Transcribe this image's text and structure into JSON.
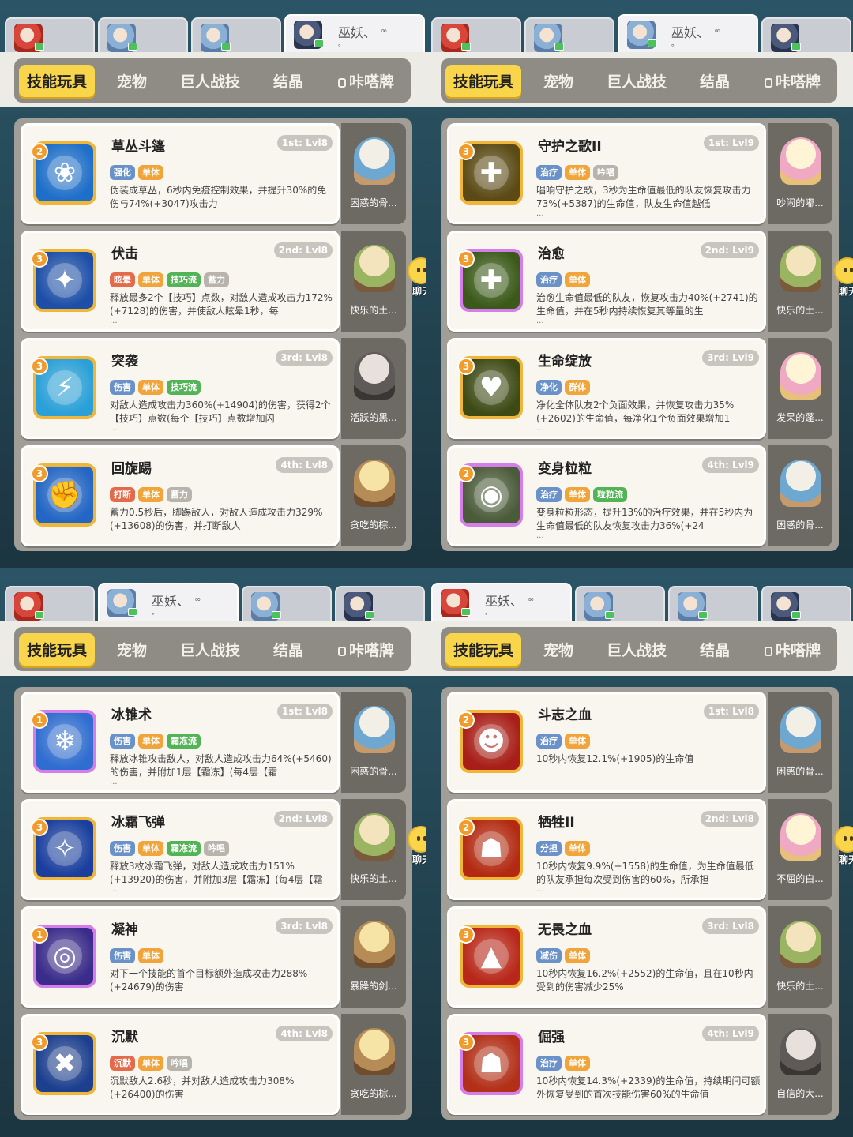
{
  "colors": {
    "tag_blue": "#6a91c8",
    "tag_orange": "#f0a43a",
    "tag_green": "#52b456",
    "tag_gray": "#b8b4ac",
    "tag_red": "#e36a4a",
    "tag_purple": "#a97ad8",
    "highlight_green": "#3b9b3f"
  },
  "panels": [
    {
      "char_tabs": [
        {
          "avatar": "red",
          "name": "",
          "active": false
        },
        {
          "avatar": "blue",
          "name": "",
          "active": false
        },
        {
          "avatar": "blue",
          "name": "",
          "active": false
        },
        {
          "avatar": "dark",
          "name": "巫妖、",
          "dots": "∞",
          "small": "。",
          "active": true
        }
      ],
      "menu": [
        "技能玩具",
        "宠物",
        "巨人战技",
        "结晶",
        "咔嗒牌"
      ],
      "cards": [
        {
          "badge": "2",
          "name": "草丛斗篷",
          "level": "1st: Lvl8",
          "icon": "❀",
          "icon_bg": "#1e6fc9",
          "icon_frame": "gold",
          "tags": [
            {
              "t": "强化",
              "c": "blue"
            },
            {
              "t": "单体",
              "c": "orange"
            }
          ],
          "desc": "伪装成草丛，6秒内免疫控制效果，并提升30%的免伤与74%(+3047)攻击力",
          "more": "",
          "pet": "困惑的骨...",
          "pet_style": "",
          "chat": false
        },
        {
          "badge": "3",
          "name": "伏击",
          "level": "2nd: Lvl8",
          "icon": "✦",
          "icon_bg": "#1d4fa8",
          "icon_frame": "gold",
          "tags": [
            {
              "t": "眩晕",
              "c": "red"
            },
            {
              "t": "单体",
              "c": "orange"
            },
            {
              "t": "技巧流",
              "c": "green"
            },
            {
              "t": "蓄力",
              "c": "gray"
            }
          ],
          "desc": "释放最多2个【技巧】点数，对敌人造成攻击力172%(+7128)的伤害，并使敌人眩晕1秒，每",
          "more": "...",
          "pet": "快乐的土...",
          "pet_style": "green",
          "chat": true
        },
        {
          "badge": "3",
          "name": "突袭",
          "level": "3rd: Lvl8",
          "icon": "⚡",
          "icon_bg": "#2aa0d8",
          "icon_frame": "gold",
          "tags": [
            {
              "t": "伤害",
              "c": "blue"
            },
            {
              "t": "单体",
              "c": "orange"
            },
            {
              "t": "技巧流",
              "c": "green"
            }
          ],
          "desc": "对敌人造成攻击力360%(+14904)的伤害，获得2个【技巧】点数(每个【技巧】点数增加闪",
          "more": "...",
          "pet": "活跃的黑...",
          "pet_style": "dark",
          "chat": false
        },
        {
          "badge": "3",
          "name": "回旋踢",
          "level": "4th: Lvl8",
          "icon": "✊",
          "icon_bg": "#2366c4",
          "icon_frame": "gold",
          "tags": [
            {
              "t": "打断",
              "c": "red"
            },
            {
              "t": "单体",
              "c": "orange"
            },
            {
              "t": "蓄力",
              "c": "gray"
            }
          ],
          "desc": "蓄力0.5秒后，脚踢敌人，对敌人造成攻击力329%(+13608)的伤害，并打断敌人",
          "more": "",
          "pet": "贪吃的棕...",
          "pet_style": "brown",
          "chat": false
        }
      ]
    },
    {
      "char_tabs": [
        {
          "avatar": "red",
          "name": "",
          "active": false
        },
        {
          "avatar": "blue",
          "name": "",
          "active": false
        },
        {
          "avatar": "blue",
          "name": "巫妖、",
          "dots": "∞",
          "small": "。",
          "active": true
        },
        {
          "avatar": "dark",
          "name": "",
          "active": false
        }
      ],
      "menu": [
        "技能玩具",
        "宠物",
        "巨人战技",
        "结晶",
        "咔嗒牌"
      ],
      "cards": [
        {
          "badge": "3",
          "name": "守护之歌II",
          "level": "1st: Lvl9",
          "icon": "✚",
          "icon_bg": "#5b4a16",
          "icon_frame": "gold",
          "tags": [
            {
              "t": "治疗",
              "c": "blue"
            },
            {
              "t": "单体",
              "c": "orange"
            },
            {
              "t": "吟唱",
              "c": "gray"
            }
          ],
          "desc": "唱响守护之歌，3秒为生命值最低的队友恢复攻击力73%(+5387)的生命值，队友生命值越低",
          "more": "...",
          "pet": "吵闹的嘟...",
          "pet_style": "pink",
          "chat": false
        },
        {
          "badge": "3",
          "name": "治愈",
          "level": "2nd: Lvl9",
          "icon": "✚",
          "icon_bg": "#3b5a1a",
          "icon_frame": "purple",
          "tags": [
            {
              "t": "治疗",
              "c": "blue"
            },
            {
              "t": "单体",
              "c": "orange"
            }
          ],
          "desc": "治愈生命值最低的队友，恢复攻击力40%(+2741)的生命值，并在5秒内持续恢复其等量的生",
          "more": "...",
          "pet": "快乐的土...",
          "pet_style": "green",
          "chat": true
        },
        {
          "badge": "3",
          "name": "生命绽放",
          "level": "3rd: Lvl9",
          "icon": "♥",
          "icon_bg": "#3e4a16",
          "icon_frame": "gold",
          "tags": [
            {
              "t": "净化",
              "c": "blue"
            },
            {
              "t": "群体",
              "c": "orange"
            }
          ],
          "desc": "净化全体队友2个负面效果，并恢复攻击力35%(+2602)的生命值，每净化1个负面效果增加1",
          "more": "...",
          "pet": "发呆的蓬...",
          "pet_style": "pink",
          "chat": false
        },
        {
          "badge": "2",
          "name": "变身粒粒",
          "level": "4th: Lvl9",
          "icon": "◉",
          "icon_bg": "#4a5b3a",
          "icon_frame": "purple",
          "tags": [
            {
              "t": "治疗",
              "c": "blue"
            },
            {
              "t": "单体",
              "c": "orange"
            },
            {
              "t": "粒粒流",
              "c": "green"
            }
          ],
          "desc": "变身粒粒形态，提升13%的治疗效果，并在5秒内为生命值最低的队友恢复攻击力36%(+24",
          "more": "...",
          "pet": "困惑的骨...",
          "pet_style": "",
          "chat": false
        }
      ]
    },
    {
      "char_tabs": [
        {
          "avatar": "red",
          "name": "",
          "active": false
        },
        {
          "avatar": "blue",
          "name": "巫妖、",
          "dots": "∞",
          "small": "。",
          "active": true
        },
        {
          "avatar": "blue",
          "name": "",
          "active": false
        },
        {
          "avatar": "dark",
          "name": "",
          "active": false
        }
      ],
      "menu": [
        "技能玩具",
        "宠物",
        "巨人战技",
        "结晶",
        "咔嗒牌"
      ],
      "cards": [
        {
          "badge": "1",
          "name": "冰锥术",
          "level": "1st: Lvl8",
          "icon": "❄",
          "icon_bg": "#2f6dd0",
          "icon_frame": "purple",
          "tags": [
            {
              "t": "伤害",
              "c": "blue"
            },
            {
              "t": "单体",
              "c": "orange"
            },
            {
              "t": "霜冻流",
              "c": "green"
            }
          ],
          "desc": "释放冰锥攻击敌人，对敌人造成攻击力64%(+5460)的伤害，并附加1层【霜冻】(每4层【霜",
          "more": "...",
          "pet": "困惑的骨...",
          "pet_style": "",
          "chat": false
        },
        {
          "badge": "3",
          "name": "冰霜飞弹",
          "level": "2nd: Lvl8",
          "icon": "✧",
          "icon_bg": "#1a3f9e",
          "icon_frame": "gold",
          "tags": [
            {
              "t": "伤害",
              "c": "blue"
            },
            {
              "t": "单体",
              "c": "orange"
            },
            {
              "t": "霜冻流",
              "c": "green"
            },
            {
              "t": "吟唱",
              "c": "gray"
            }
          ],
          "desc": "释放3枚冰霜飞弹，对敌人造成攻击力151%(+13920)的伤害，并附加3层【霜冻】(每4层【霜",
          "more": "...",
          "pet": "快乐的土...",
          "pet_style": "green",
          "chat": true
        },
        {
          "badge": "1",
          "name": "凝神",
          "level": "3rd: Lvl8",
          "icon": "◎",
          "icon_bg": "#3a2c8a",
          "icon_frame": "purple",
          "tags": [
            {
              "t": "伤害",
              "c": "blue"
            },
            {
              "t": "单体",
              "c": "orange"
            }
          ],
          "desc": "对下一个技能的首个目标额外造成攻击力288%(+24679)的伤害",
          "more": "",
          "pet": "暴躁的剑...",
          "pet_style": "brown",
          "chat": false
        },
        {
          "badge": "3",
          "name": "沉默",
          "level": "4th: Lvl8",
          "icon": "✖",
          "icon_bg": "#1c3f8e",
          "icon_frame": "gold",
          "tags": [
            {
              "t": "沉默",
              "c": "red"
            },
            {
              "t": "单体",
              "c": "orange"
            },
            {
              "t": "吟唱",
              "c": "gray"
            }
          ],
          "desc": "沉默敌人2.6秒，并对敌人造成攻击力308%(+26400)的伤害",
          "more": "",
          "pet": "贪吃的棕...",
          "pet_style": "brown",
          "chat": false
        }
      ]
    },
    {
      "char_tabs": [
        {
          "avatar": "red",
          "name": "巫妖、",
          "dots": "∞",
          "small": "。",
          "active": true
        },
        {
          "avatar": "blue",
          "name": "",
          "active": false
        },
        {
          "avatar": "blue",
          "name": "",
          "active": false
        },
        {
          "avatar": "dark",
          "name": "",
          "active": false
        }
      ],
      "menu": [
        "技能玩具",
        "宠物",
        "巨人战技",
        "结晶",
        "咔嗒牌"
      ],
      "cards": [
        {
          "badge": "2",
          "name": "斗志之血",
          "level": "1st: Lvl8",
          "icon": "☻",
          "icon_bg": "#a81e18",
          "icon_frame": "gold",
          "tags": [
            {
              "t": "治疗",
              "c": "blue"
            },
            {
              "t": "单体",
              "c": "orange"
            }
          ],
          "desc": "10秒内恢复12.1%(+1905)的生命值",
          "more": "",
          "pet": "困惑的骨...",
          "pet_style": "",
          "chat": false
        },
        {
          "badge": "2",
          "name": "牺牲II",
          "level": "2nd: Lvl8",
          "icon": "☗",
          "icon_bg": "#b32a12",
          "icon_frame": "gold",
          "tags": [
            {
              "t": "分担",
              "c": "blue"
            },
            {
              "t": "单体",
              "c": "orange"
            }
          ],
          "desc": "10秒内恢复9.9%(+1558)的生命值，为生命值最低的队友承担每次受到伤害的60%，所承担",
          "more": "...",
          "pet": "不屈的白...",
          "pet_style": "pink",
          "chat": true
        },
        {
          "badge": "3",
          "name": "无畏之血",
          "level": "3rd: Lvl8",
          "icon": "▲",
          "icon_bg": "#b8281a",
          "icon_frame": "gold",
          "tags": [
            {
              "t": "减伤",
              "c": "blue"
            },
            {
              "t": "单体",
              "c": "orange"
            }
          ],
          "desc": "10秒内恢复16.2%(+2552)的生命值，且在10秒内受到的伤害减少25%",
          "more": "",
          "pet": "快乐的土...",
          "pet_style": "green",
          "chat": false
        },
        {
          "badge": "3",
          "name": "倔强",
          "level": "4th: Lvl9",
          "icon": "☗",
          "icon_bg": "#b23018",
          "icon_frame": "purple",
          "tags": [
            {
              "t": "治疗",
              "c": "blue"
            },
            {
              "t": "单体",
              "c": "orange"
            }
          ],
          "desc": "10秒内恢复14.3%(+2339)的生命值，持续期间可额外恢复受到的首次技能伤害60%的生命值",
          "more": "",
          "pet": "自信的大...",
          "pet_style": "dark",
          "chat": false
        }
      ]
    }
  ],
  "chat_label": "聊天"
}
